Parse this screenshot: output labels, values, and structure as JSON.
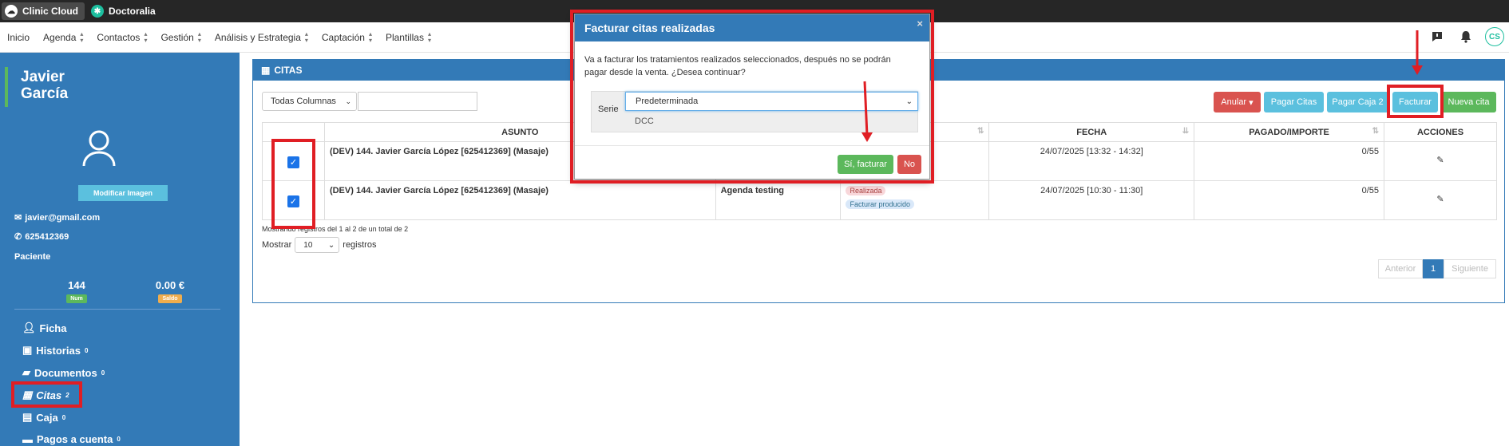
{
  "topbar": {
    "apps": [
      {
        "label": "Clinic Cloud"
      },
      {
        "label": "Doctoralia"
      }
    ]
  },
  "nav": {
    "items": [
      "Inicio",
      "Agenda",
      "Contactos",
      "Gestión",
      "Análisis y Estrategia",
      "Captación",
      "Plantillas"
    ],
    "avatar": "CS"
  },
  "sidebar": {
    "first_name": "Javier",
    "last_name": "García",
    "modify_image": "Modificar Imagen",
    "email": "javier@gmail.com",
    "phone": "625412369",
    "role": "Paciente",
    "stats": [
      {
        "value": "144",
        "badge": "Num",
        "color": "#5cb85c"
      },
      {
        "value": "0.00 €",
        "badge": "Saldo",
        "color": "#f0ad4e"
      }
    ],
    "menu": [
      {
        "label": "Ficha",
        "count": ""
      },
      {
        "label": "Historias",
        "count": "0"
      },
      {
        "label": "Documentos",
        "count": "0"
      },
      {
        "label": "Citas",
        "count": "2"
      },
      {
        "label": "Caja",
        "count": "0"
      },
      {
        "label": "Pagos a cuenta",
        "count": "0"
      }
    ]
  },
  "panel": {
    "title": "CITAS",
    "columns_select": "Todas Columnas",
    "buttons": {
      "anular": "Anular",
      "pagar_citas": "Pagar Citas",
      "pagar_caja2": "Pagar Caja 2",
      "facturar": "Facturar",
      "nueva_cita": "Nueva cita"
    },
    "table": {
      "headers": [
        "ASUNTO",
        "",
        "",
        "FECHA",
        "PAGADO/IMPORTE",
        "ACCIONES"
      ],
      "rows": [
        {
          "asunto": "(DEV) 144. Javier García López [625412369] (Masaje)",
          "agenda": "",
          "estado": "",
          "facturado": "",
          "fecha": "24/07/2025 [13:32 - 14:32]",
          "importe": "0/55"
        },
        {
          "asunto": "(DEV) 144. Javier García López [625412369] (Masaje)",
          "agenda": "Agenda testing",
          "estado": "Realizada",
          "facturado": "Facturar producido",
          "fecha": "24/07/2025 [10:30 - 11:30]",
          "importe": "0/55"
        }
      ]
    },
    "info": "Mostrando registros del 1 al 2 de un total de 2",
    "show_label": "Mostrar",
    "show_value": "10",
    "records_label": "registros",
    "pager": {
      "prev": "Anterior",
      "page": "1",
      "next": "Siguiente"
    }
  },
  "modal": {
    "title": "Facturar citas realizadas",
    "close": "×",
    "message": "Va a facturar los tratamientos realizados seleccionados, después no se podrán pagar desde la venta. ¿Desea continuar?",
    "serie_label": "Serie",
    "serie_value": "Predeterminada",
    "serie_option": "DCC",
    "confirm": "Sí, facturar",
    "cancel": "No"
  },
  "colors": {
    "primary": "#337ab7",
    "annotation": "#e01e24"
  }
}
